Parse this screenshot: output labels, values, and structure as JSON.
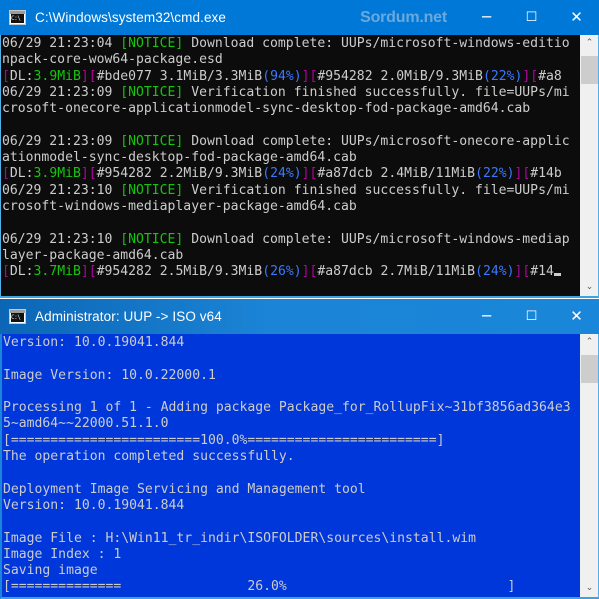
{
  "windows": [
    {
      "id": "cmd",
      "icon_name": "cmd-app-icon",
      "title": "C:\\Windows\\system32\\cmd.exe",
      "watermark": "Sordum.net",
      "controls": {
        "minimize": "─",
        "maximize": "☐",
        "close": "✕"
      },
      "scrollbar": {
        "up_arrow": "⌃",
        "down_arrow": "⌄"
      },
      "console": {
        "background_color": "#0c0c0c",
        "foreground_color": "#cccccc",
        "lines": [
          [
            {
              "t": "06/29 21:23:04 ",
              "c": "white"
            },
            {
              "t": "[NOTICE]",
              "c": "green"
            },
            {
              "t": " Download complete: UUPs/microsoft-windows-editio",
              "c": "white"
            }
          ],
          [
            {
              "t": "npack-core-wow64-package.esd",
              "c": "white"
            }
          ],
          [
            {
              "t": "[",
              "c": "magenta"
            },
            {
              "t": "DL:",
              "c": "white"
            },
            {
              "t": "3.9MiB",
              "c": "green"
            },
            {
              "t": "]",
              "c": "magenta"
            },
            {
              "t": "[",
              "c": "magenta"
            },
            {
              "t": "#bde077 3.1MiB/3.3MiB",
              "c": "white"
            },
            {
              "t": "(94%)",
              "c": "cyan"
            },
            {
              "t": "]",
              "c": "magenta"
            },
            {
              "t": "[",
              "c": "magenta"
            },
            {
              "t": "#954282 2.0MiB/9.3MiB",
              "c": "white"
            },
            {
              "t": "(22%)",
              "c": "cyan"
            },
            {
              "t": "]",
              "c": "magenta"
            },
            {
              "t": "[",
              "c": "magenta"
            },
            {
              "t": "#a8",
              "c": "white"
            }
          ],
          [
            {
              "t": "06/29 21:23:09 ",
              "c": "white"
            },
            {
              "t": "[NOTICE]",
              "c": "green"
            },
            {
              "t": " Verification finished successfully. file=UUPs/mi",
              "c": "white"
            }
          ],
          [
            {
              "t": "crosoft-onecore-applicationmodel-sync-desktop-fod-package-amd64.cab",
              "c": "white"
            }
          ],
          [
            {
              "t": "",
              "c": "white"
            }
          ],
          [
            {
              "t": "06/29 21:23:09 ",
              "c": "white"
            },
            {
              "t": "[NOTICE]",
              "c": "green"
            },
            {
              "t": " Download complete: UUPs/microsoft-onecore-applic",
              "c": "white"
            }
          ],
          [
            {
              "t": "ationmodel-sync-desktop-fod-package-amd64.cab",
              "c": "white"
            }
          ],
          [
            {
              "t": "[",
              "c": "magenta"
            },
            {
              "t": "DL:",
              "c": "white"
            },
            {
              "t": "3.9MiB",
              "c": "green"
            },
            {
              "t": "]",
              "c": "magenta"
            },
            {
              "t": "[",
              "c": "magenta"
            },
            {
              "t": "#954282 2.2MiB/9.3MiB",
              "c": "white"
            },
            {
              "t": "(24%)",
              "c": "cyan"
            },
            {
              "t": "]",
              "c": "magenta"
            },
            {
              "t": "[",
              "c": "magenta"
            },
            {
              "t": "#a87dcb 2.4MiB/11MiB",
              "c": "white"
            },
            {
              "t": "(22%)",
              "c": "cyan"
            },
            {
              "t": "]",
              "c": "magenta"
            },
            {
              "t": "[",
              "c": "magenta"
            },
            {
              "t": "#14b",
              "c": "white"
            }
          ],
          [
            {
              "t": "06/29 21:23:10 ",
              "c": "white"
            },
            {
              "t": "[NOTICE]",
              "c": "green"
            },
            {
              "t": " Verification finished successfully. file=UUPs/mi",
              "c": "white"
            }
          ],
          [
            {
              "t": "crosoft-windows-mediaplayer-package-amd64.cab",
              "c": "white"
            }
          ],
          [
            {
              "t": "",
              "c": "white"
            }
          ],
          [
            {
              "t": "06/29 21:23:10 ",
              "c": "white"
            },
            {
              "t": "[NOTICE]",
              "c": "green"
            },
            {
              "t": " Download complete: UUPs/microsoft-windows-mediap",
              "c": "white"
            }
          ],
          [
            {
              "t": "layer-package-amd64.cab",
              "c": "white"
            }
          ],
          [
            {
              "t": "[",
              "c": "magenta"
            },
            {
              "t": "DL:",
              "c": "white"
            },
            {
              "t": "3.7MiB",
              "c": "green"
            },
            {
              "t": "]",
              "c": "magenta"
            },
            {
              "t": "[",
              "c": "magenta"
            },
            {
              "t": "#954282 2.5MiB/9.3MiB",
              "c": "white"
            },
            {
              "t": "(26%)",
              "c": "cyan"
            },
            {
              "t": "]",
              "c": "magenta"
            },
            {
              "t": "[",
              "c": "magenta"
            },
            {
              "t": "#a87dcb 2.7MiB/11MiB",
              "c": "white"
            },
            {
              "t": "(24%)",
              "c": "cyan"
            },
            {
              "t": "]",
              "c": "magenta"
            },
            {
              "t": "[",
              "c": "magenta"
            },
            {
              "t": "#14",
              "c": "white"
            },
            {
              "t": "█",
              "c": "cursor"
            }
          ]
        ]
      }
    },
    {
      "id": "uup",
      "icon_name": "cmd-app-icon",
      "title": "Administrator:  UUP -> ISO v64",
      "watermark": "",
      "controls": {
        "minimize": "─",
        "maximize": "☐",
        "close": "✕"
      },
      "scrollbar": {
        "up_arrow": "⌃",
        "down_arrow": "⌄"
      },
      "console": {
        "background_color": "#0037da",
        "foreground_color": "#f2f2f2",
        "lines": [
          [
            {
              "t": "Version: 10.0.19041.844",
              "c": "white"
            }
          ],
          [
            {
              "t": "",
              "c": "white"
            }
          ],
          [
            {
              "t": "Image Version: 10.0.22000.1",
              "c": "white"
            }
          ],
          [
            {
              "t": "",
              "c": "white"
            }
          ],
          [
            {
              "t": "Processing 1 of 1 - Adding package Package_for_RollupFix~31bf3856ad364e3",
              "c": "white"
            }
          ],
          [
            {
              "t": "5~amd64~~22000.51.1.0",
              "c": "white"
            }
          ],
          [
            {
              "t": "[========================100.0%========================]",
              "c": "white"
            }
          ],
          [
            {
              "t": "The operation completed successfully.",
              "c": "white"
            }
          ],
          [
            {
              "t": "",
              "c": "white"
            }
          ],
          [
            {
              "t": "Deployment Image Servicing and Management tool",
              "c": "white"
            }
          ],
          [
            {
              "t": "Version: 10.0.19041.844",
              "c": "white"
            }
          ],
          [
            {
              "t": "",
              "c": "white"
            }
          ],
          [
            {
              "t": "Image File : H:\\Win11_tr_indir\\ISOFOLDER\\sources\\install.wim",
              "c": "white"
            }
          ],
          [
            {
              "t": "Image Index : 1",
              "c": "white"
            }
          ],
          [
            {
              "t": "Saving image",
              "c": "white"
            }
          ],
          [
            {
              "t": "[==============                26.0%                            ]",
              "c": "white"
            }
          ]
        ]
      }
    }
  ]
}
